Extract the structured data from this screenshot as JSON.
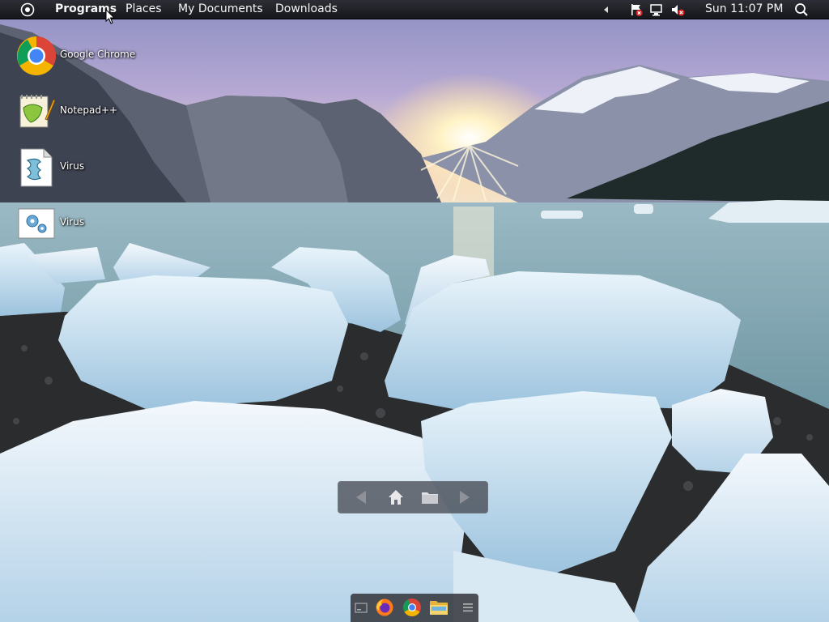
{
  "topbar": {
    "menus": [
      {
        "label": "Programs",
        "active": true
      },
      {
        "label": "Places",
        "active": false
      },
      {
        "label": "My Documents",
        "active": false
      },
      {
        "label": "Downloads",
        "active": false
      }
    ],
    "clock": "Sun 11:07 PM",
    "icons": {
      "logo": "circle-dot-icon",
      "tray_arrow": "tray-left-arrow-icon",
      "flag": "action-center-flag-icon",
      "network": "network-disconnected-icon",
      "volume": "volume-muted-icon",
      "search": "search-icon"
    }
  },
  "desktop": {
    "icons": [
      {
        "label": "Google Chrome",
        "icon": "chrome-icon"
      },
      {
        "label": "Notepad++",
        "icon": "notepad-plus-plus-icon"
      },
      {
        "label": "Virus",
        "icon": "script-file-icon"
      },
      {
        "label": "Virus",
        "icon": "settings-file-icon"
      }
    ]
  },
  "navpill": {
    "icons": [
      "back-arrow-icon",
      "home-icon",
      "folder-icon",
      "forward-arrow-icon"
    ]
  },
  "dock": {
    "icons": [
      "terminal-icon",
      "firefox-icon",
      "chrome-icon",
      "file-manager-icon",
      "app-menu-icon"
    ]
  },
  "colors": {
    "panel": "#1e1f24",
    "chrome_red": "#db4437",
    "chrome_green": "#0f9d58",
    "chrome_yellow": "#f4b400",
    "chrome_blue": "#4285f4"
  }
}
